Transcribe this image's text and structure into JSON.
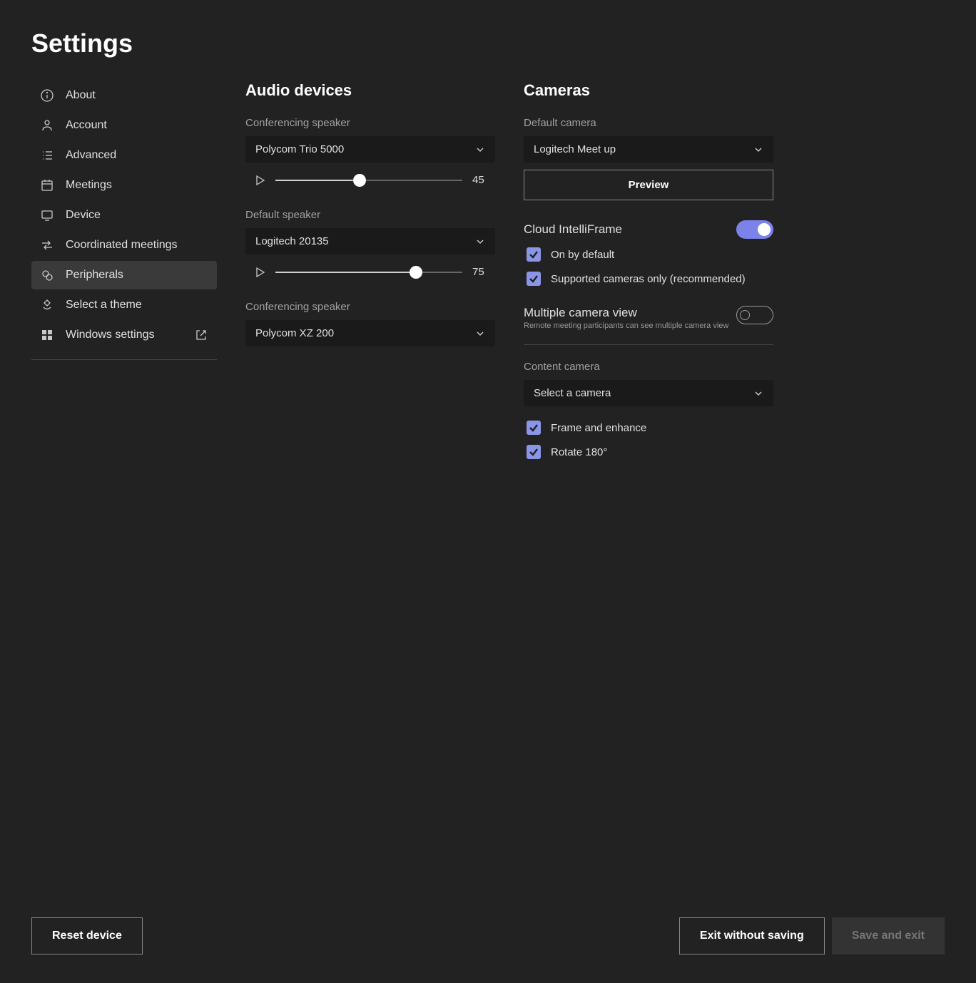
{
  "page_title": "Settings",
  "sidebar": {
    "items": [
      {
        "label": "About"
      },
      {
        "label": "Account"
      },
      {
        "label": "Advanced"
      },
      {
        "label": "Meetings"
      },
      {
        "label": "Device"
      },
      {
        "label": "Coordinated meetings"
      },
      {
        "label": "Peripherals"
      },
      {
        "label": "Select a theme"
      },
      {
        "label": "Windows settings"
      }
    ]
  },
  "audio": {
    "section_title": "Audio devices",
    "conferencing_speaker_label": "Conferencing speaker",
    "conferencing_speaker_value": "Polycom Trio 5000",
    "conferencing_speaker_volume": "45",
    "default_speaker_label": "Default speaker",
    "default_speaker_value": "Logitech 20135",
    "default_speaker_volume": "75",
    "conferencing_speaker2_label": "Conferencing speaker",
    "conferencing_speaker2_value": "Polycom XZ 200"
  },
  "cameras": {
    "section_title": "Cameras",
    "default_camera_label": "Default camera",
    "default_camera_value": "Logitech Meet up",
    "preview_label": "Preview",
    "cloud_intelliframe_label": "Cloud IntelliFrame",
    "on_by_default_label": "On by default",
    "supported_only_label": "Supported cameras only (recommended)",
    "multiple_view_label": "Multiple camera view",
    "multiple_view_subtext": "Remote meeting participants can see multiple camera view",
    "content_camera_label": "Content camera",
    "content_camera_value": "Select a camera",
    "frame_enhance_label": "Frame and enhance",
    "rotate_label": "Rotate 180°"
  },
  "footer": {
    "reset_label": "Reset device",
    "exit_label": "Exit without saving",
    "save_label": "Save and exit"
  }
}
